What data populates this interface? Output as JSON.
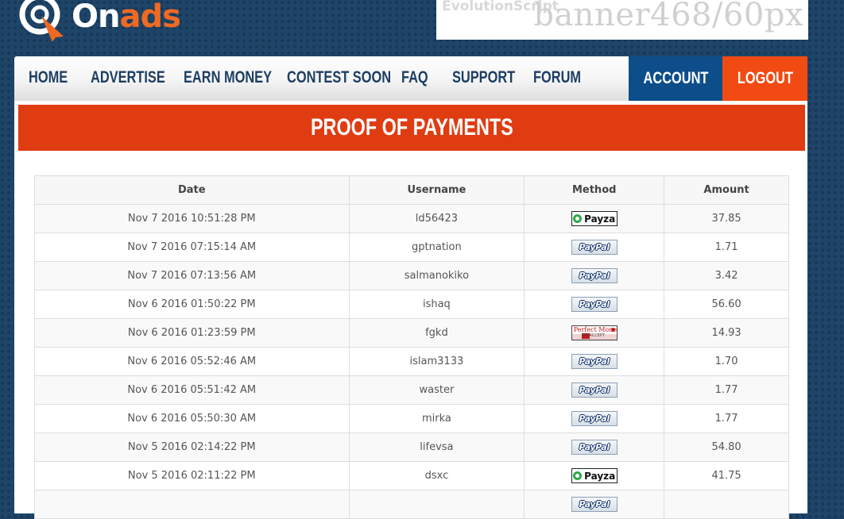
{
  "logo": {
    "part1": "On",
    "part2": "ads"
  },
  "banner": {
    "brand": "EvolutionScript",
    "text": "banner468/60px"
  },
  "nav": {
    "items": [
      "HOME",
      "ADVERTISE",
      "EARN MONEY",
      "CONTEST SOON",
      "FAQ",
      "SUPPORT",
      "FORUM"
    ],
    "account": "ACCOUNT",
    "logout": "LOGOUT"
  },
  "page": {
    "title": "PROOF OF PAYMENTS"
  },
  "table": {
    "headers": [
      "Date",
      "Username",
      "Method",
      "Amount"
    ],
    "rows": [
      {
        "date": "Nov 7 2016 10:51:28 PM",
        "username": "ld56423",
        "method": "Payza",
        "amount": "37.85"
      },
      {
        "date": "Nov 7 2016 07:15:14 AM",
        "username": "gptnation",
        "method": "PayPal",
        "amount": "1.71"
      },
      {
        "date": "Nov 7 2016 07:13:56 AM",
        "username": "salmanokiko",
        "method": "PayPal",
        "amount": "3.42"
      },
      {
        "date": "Nov 6 2016 01:50:22 PM",
        "username": "ishaq",
        "method": "PayPal",
        "amount": "56.60"
      },
      {
        "date": "Nov 6 2016 01:23:59 PM",
        "username": "fgkd",
        "method": "Perfect Money",
        "amount": "14.93"
      },
      {
        "date": "Nov 6 2016 05:52:46 AM",
        "username": "islam3133",
        "method": "PayPal",
        "amount": "1.70"
      },
      {
        "date": "Nov 6 2016 05:51:42 AM",
        "username": "waster",
        "method": "PayPal",
        "amount": "1.77"
      },
      {
        "date": "Nov 6 2016 05:50:30 AM",
        "username": "mirka",
        "method": "PayPal",
        "amount": "1.77"
      },
      {
        "date": "Nov 5 2016 02:14:22 PM",
        "username": "lifevsa",
        "method": "PayPal",
        "amount": "54.80"
      },
      {
        "date": "Nov 5 2016 02:11:22 PM",
        "username": "dsxc",
        "method": "Payza",
        "amount": "41.75"
      },
      {
        "date": "",
        "username": "",
        "method": "PayPal",
        "amount": ""
      }
    ]
  },
  "badges": {
    "payza": "Payza",
    "paypal": "PayPal",
    "pm_top": "Perfect Money",
    "pm_bottom": "WE ACCEPT"
  },
  "colors": {
    "background": "#1e4468",
    "brand_orange": "#f06a23",
    "nav_text": "#1d3e63",
    "account_btn": "#0d4e8a",
    "logout_btn": "#f24a13",
    "title_bar": "#df3c12"
  }
}
